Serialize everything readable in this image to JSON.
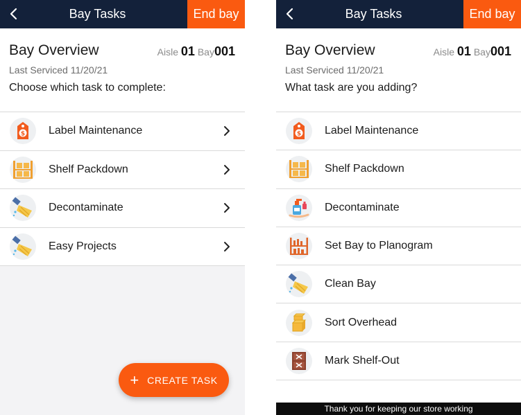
{
  "left": {
    "title": "Bay Tasks",
    "end_bay_label": "End bay",
    "overview_title": "Bay Overview",
    "aisle_label": "Aisle",
    "aisle_value": "01",
    "bay_label": "Bay",
    "bay_value": "001",
    "last_serviced": "Last Serviced 11/20/21",
    "prompt": "Choose which task to complete:",
    "tasks": [
      {
        "label": "Label Maintenance",
        "icon": "price-tag-icon"
      },
      {
        "label": "Shelf Packdown",
        "icon": "shelf-boxes-icon"
      },
      {
        "label": "Decontaminate",
        "icon": "cleaning-brush-icon"
      },
      {
        "label": "Easy Projects",
        "icon": "cleaning-brush-icon"
      }
    ],
    "create_task_label": "CREATE TASK"
  },
  "right": {
    "title": "Bay Tasks",
    "end_bay_label": "End bay",
    "overview_title": "Bay Overview",
    "aisle_label": "Aisle",
    "aisle_value": "01",
    "bay_label": "Bay",
    "bay_value": "001",
    "last_serviced": "Last Serviced 11/20/21",
    "prompt": "What task are you adding?",
    "tasks": [
      {
        "label": "Label Maintenance",
        "icon": "price-tag-icon"
      },
      {
        "label": "Shelf Packdown",
        "icon": "shelf-boxes-icon"
      },
      {
        "label": "Decontaminate",
        "icon": "sanitizer-icon"
      },
      {
        "label": "Set Bay to Planogram",
        "icon": "planogram-shelf-icon"
      },
      {
        "label": "Clean Bay",
        "icon": "cleaning-brush-icon"
      },
      {
        "label": "Sort Overhead",
        "icon": "stacked-boxes-icon"
      },
      {
        "label": "Mark Shelf-Out",
        "icon": "shelf-out-icon"
      }
    ],
    "footer": "Thank you for keeping our store working"
  },
  "colors": {
    "topbar": "#13213a",
    "accent": "#fa5a10"
  }
}
